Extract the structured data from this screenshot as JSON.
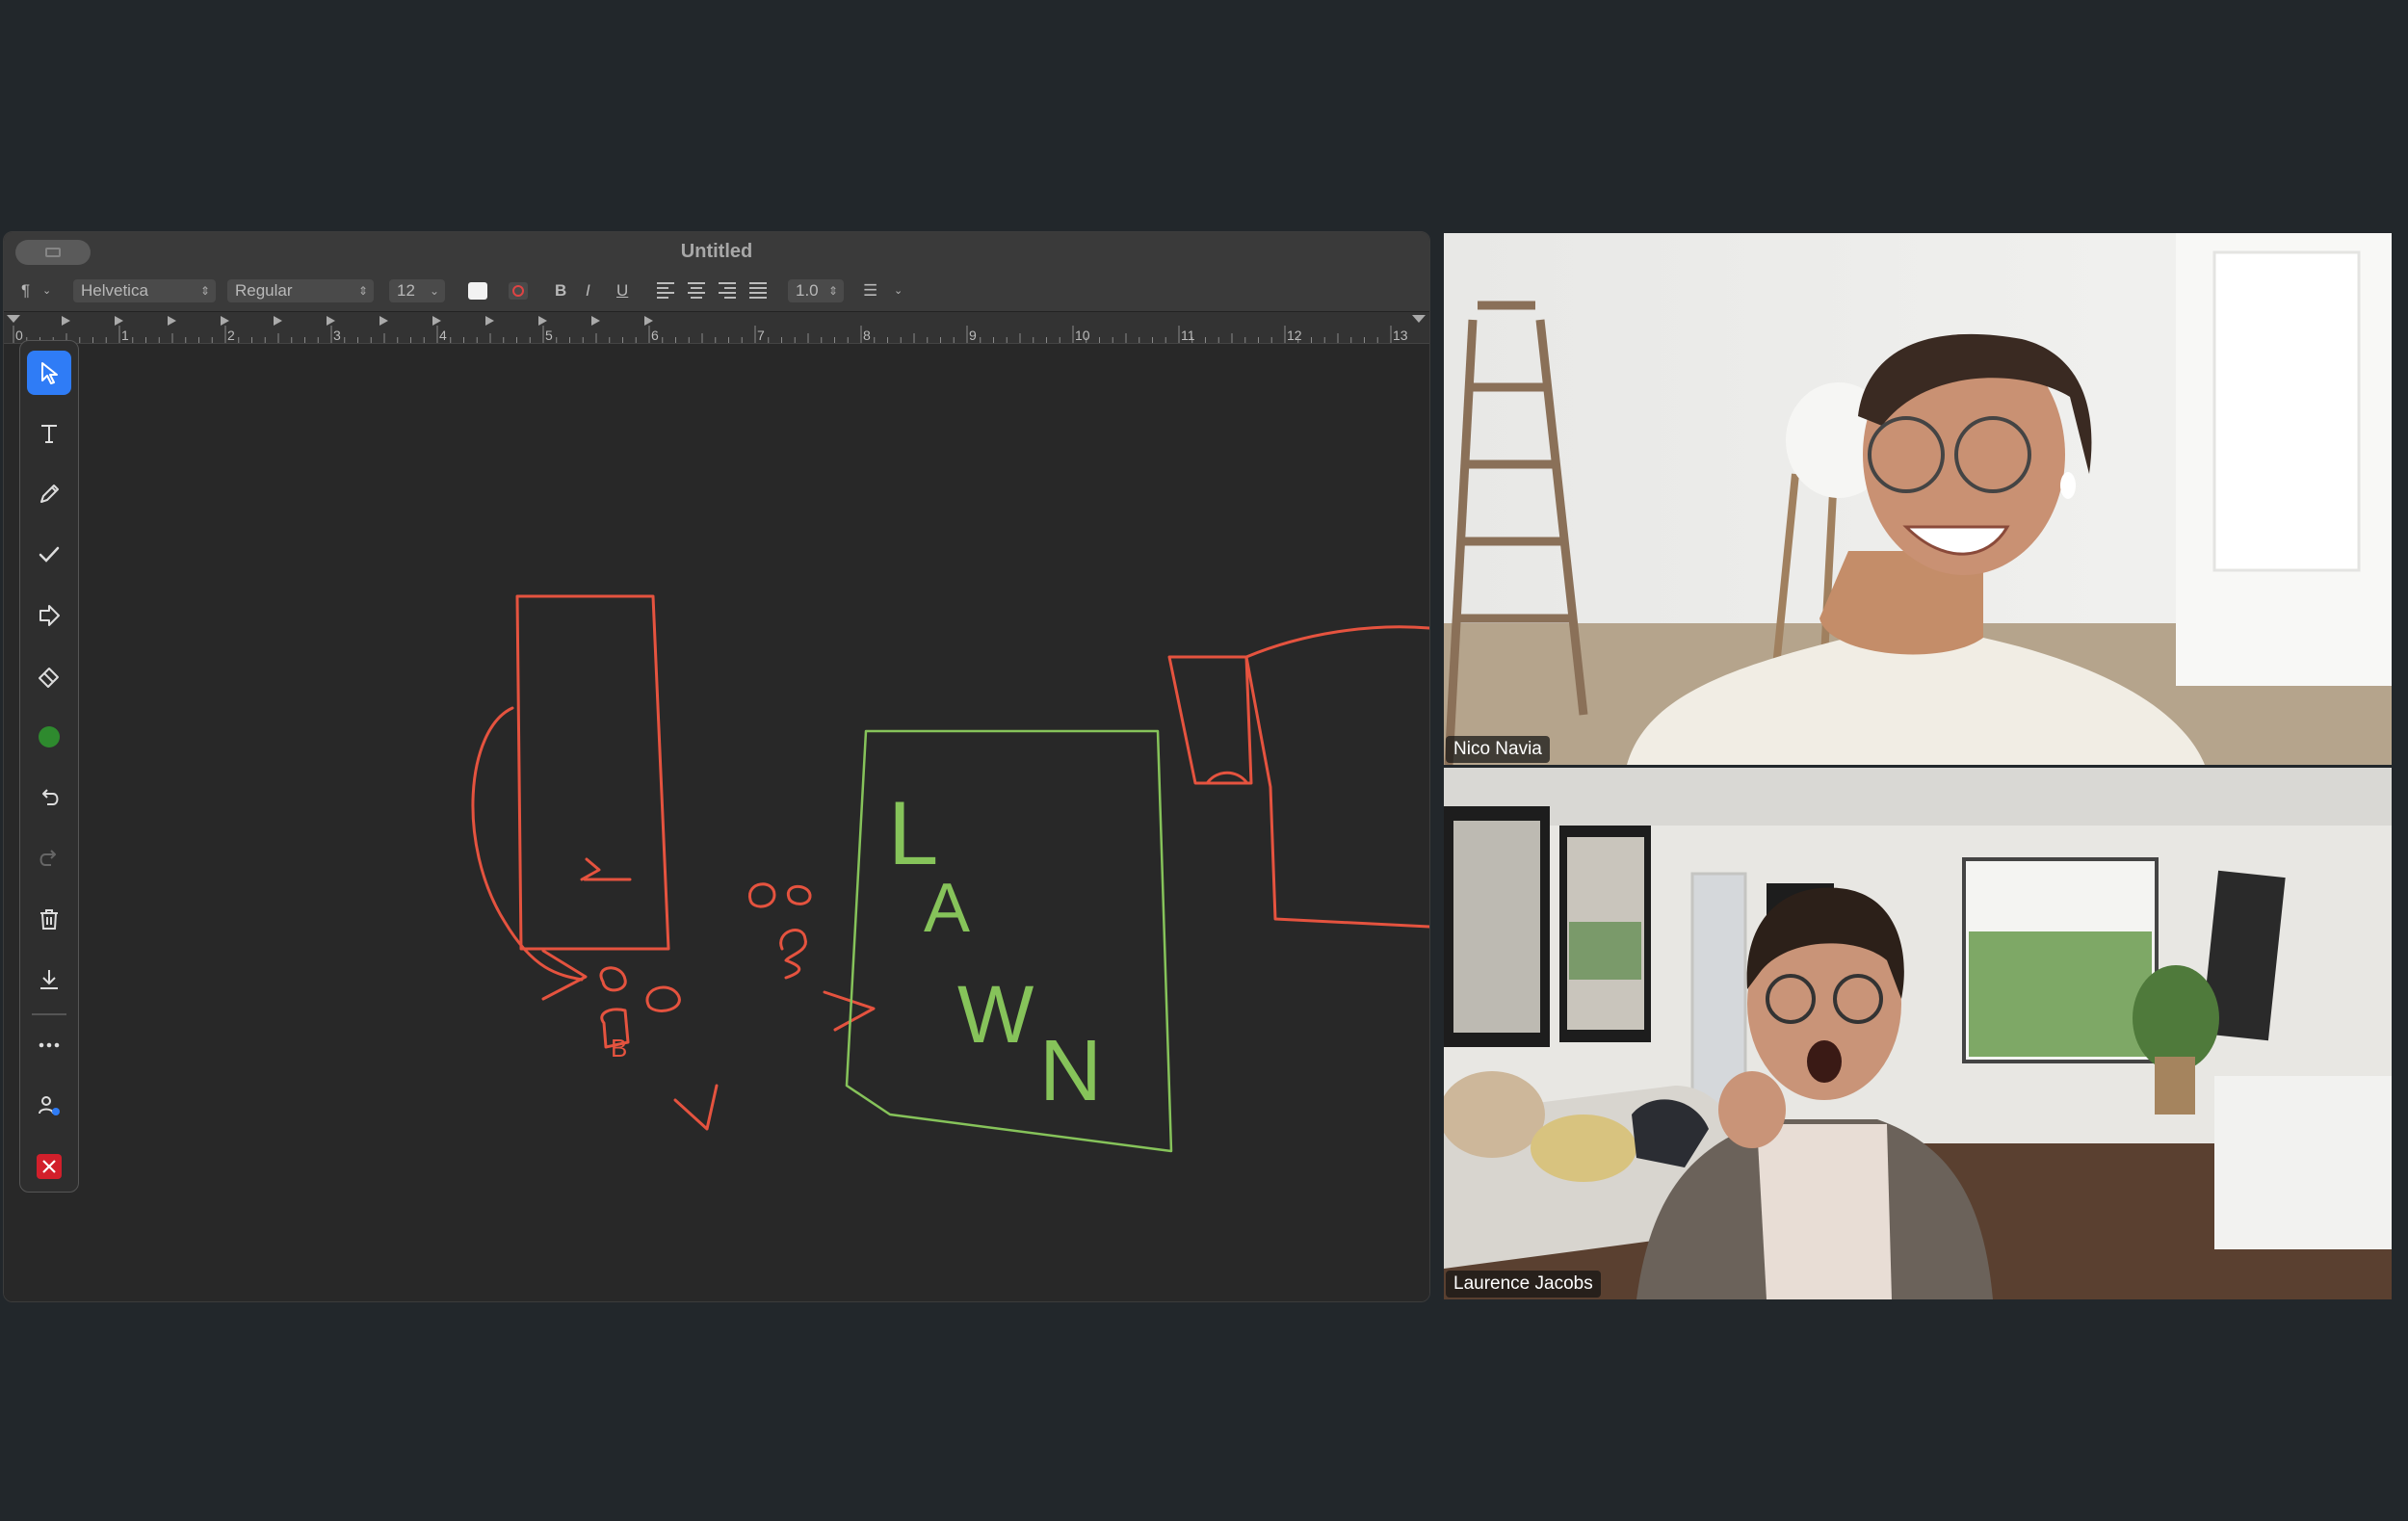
{
  "editor": {
    "title": "Untitled",
    "format_bar": {
      "paragraph_style": "¶",
      "font_family": "Helvetica",
      "font_style": "Regular",
      "font_size": "12",
      "bold": "B",
      "italic": "I",
      "underline": "U",
      "line_spacing": "1.0",
      "list_style": "☰"
    },
    "ruler_numbers": [
      "0",
      "1",
      "2",
      "3",
      "4",
      "5",
      "6",
      "7",
      "8",
      "9",
      "10",
      "11",
      "12",
      "13"
    ],
    "drawing_letters": [
      "L",
      "A",
      "W",
      "N",
      "B"
    ],
    "pen_colors": {
      "red": "#e5533f",
      "green": "#86c35a"
    }
  },
  "annotation_toolbar": {
    "tools": [
      "select-arrow",
      "text",
      "pencil",
      "checkmark",
      "arrow-shape",
      "eraser",
      "color-green",
      "undo",
      "redo",
      "trash",
      "download",
      "more",
      "participant-cursor",
      "close"
    ],
    "colors": {
      "active": "#2f7cf6",
      "green": "#2e8a2e",
      "close": "#d21f2b"
    }
  },
  "participants": [
    {
      "name": "Nico Navia"
    },
    {
      "name": "Laurence Jacobs"
    }
  ]
}
